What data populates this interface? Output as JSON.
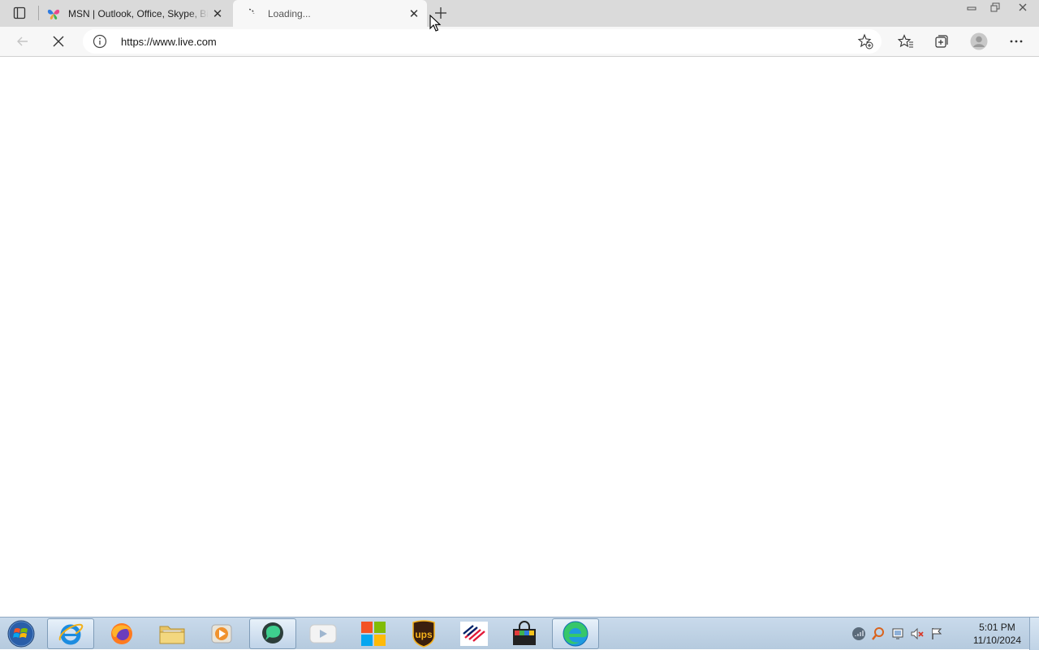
{
  "browser": {
    "tabs": [
      {
        "title": "MSN | Outlook, Office, Skype, Bing",
        "favicon": "msn-butterfly-icon",
        "active": false
      },
      {
        "title": "Loading...",
        "favicon": "loading-spinner-icon",
        "active": true
      }
    ],
    "address": {
      "url": "https://www.live.com"
    }
  },
  "taskbar": {
    "apps": [
      "internet-explorer",
      "firefox",
      "file-explorer",
      "media-player",
      "chat-app",
      "youtube",
      "microsoft-store",
      "ups",
      "bank-of-america",
      "shopping-bag",
      "edge"
    ],
    "clock": {
      "time": "5:01 PM",
      "date": "11/10/2024"
    }
  },
  "colors": {
    "taskbar_bg": "#c9daeb",
    "tabstrip_bg": "#dadada",
    "toolbar_bg": "#f7f7f7"
  }
}
